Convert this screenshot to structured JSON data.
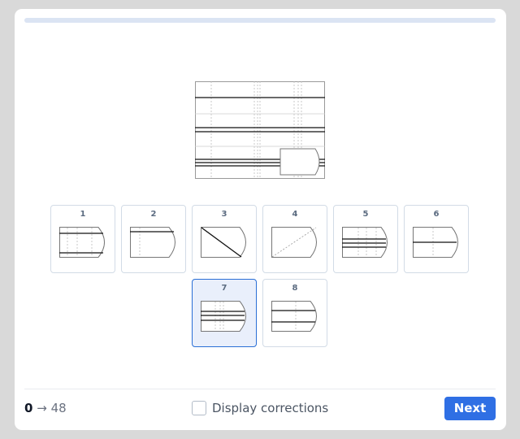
{
  "progress": {
    "value": 0
  },
  "question": {
    "image_icon": "question-panel-image"
  },
  "options": [
    {
      "label": "1",
      "variant": "v1"
    },
    {
      "label": "2",
      "variant": "v2"
    },
    {
      "label": "3",
      "variant": "v3"
    },
    {
      "label": "4",
      "variant": "v4"
    },
    {
      "label": "5",
      "variant": "v5"
    },
    {
      "label": "6",
      "variant": "v6"
    },
    {
      "label": "7",
      "variant": "v7",
      "selected": true
    },
    {
      "label": "8",
      "variant": "v8"
    }
  ],
  "footer": {
    "current": "0",
    "arrow": "→",
    "total": "48",
    "corrections_label": "Display corrections",
    "next_label": "Next"
  },
  "colors": {
    "accent": "#2f6fe4",
    "selected_bg": "#e9effb",
    "selected_border": "#2a6fd6"
  }
}
